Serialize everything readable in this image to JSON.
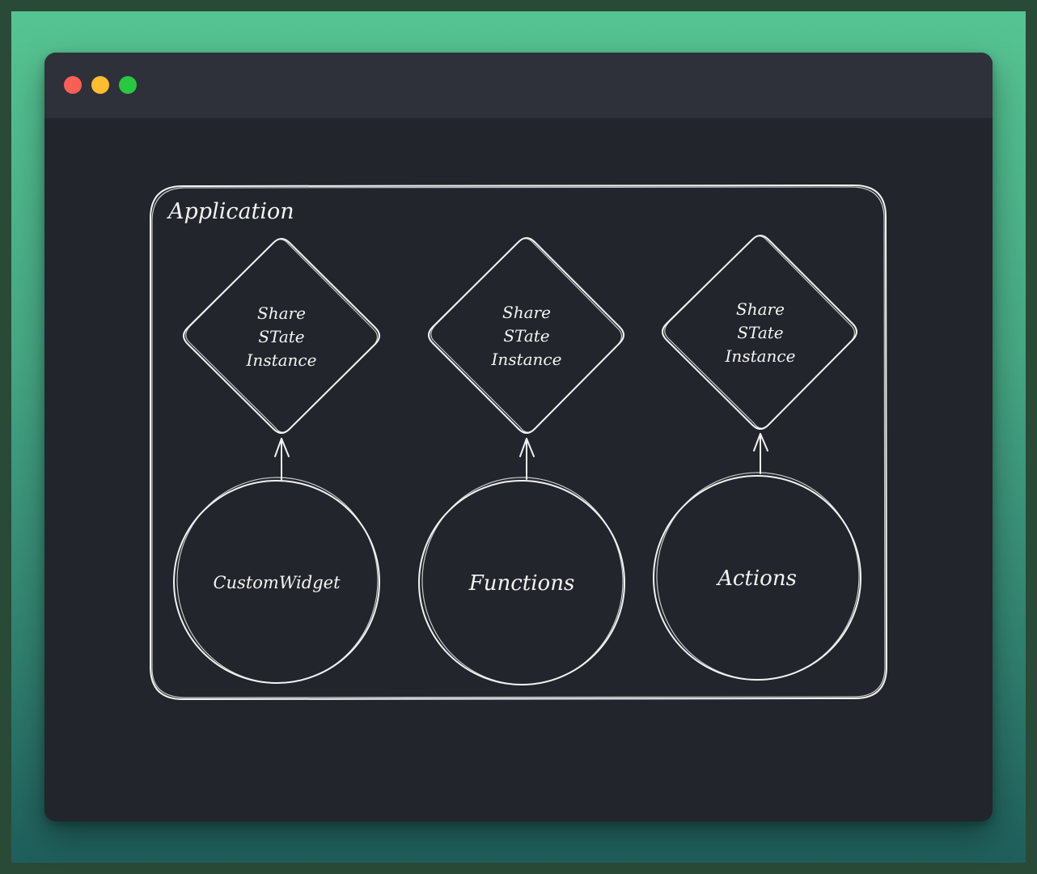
{
  "window": {
    "controls": {
      "close": "close-dot",
      "minimize": "minimize-dot",
      "zoom": "zoom-dot"
    }
  },
  "diagram": {
    "container_label": "Application",
    "state_boxes": [
      {
        "line1": "Share",
        "line2": "STate",
        "line3": "Instance"
      },
      {
        "line1": "Share",
        "line2": "STate",
        "line3": "Instance"
      },
      {
        "line1": "Share",
        "line2": "STate",
        "line3": "Instance"
      }
    ],
    "nodes": [
      {
        "label": "CustomWidget"
      },
      {
        "label": "Functions"
      },
      {
        "label": "Actions"
      }
    ]
  },
  "colors": {
    "backdrop_top": "#56c492",
    "backdrop_bottom": "#1f5e5b",
    "window_bg": "#22252b",
    "titlebar_bg": "#2e3139",
    "stroke": "#f2f2f2",
    "close": "#fd5f57",
    "minimize": "#febc2e",
    "zoom": "#28c840"
  }
}
